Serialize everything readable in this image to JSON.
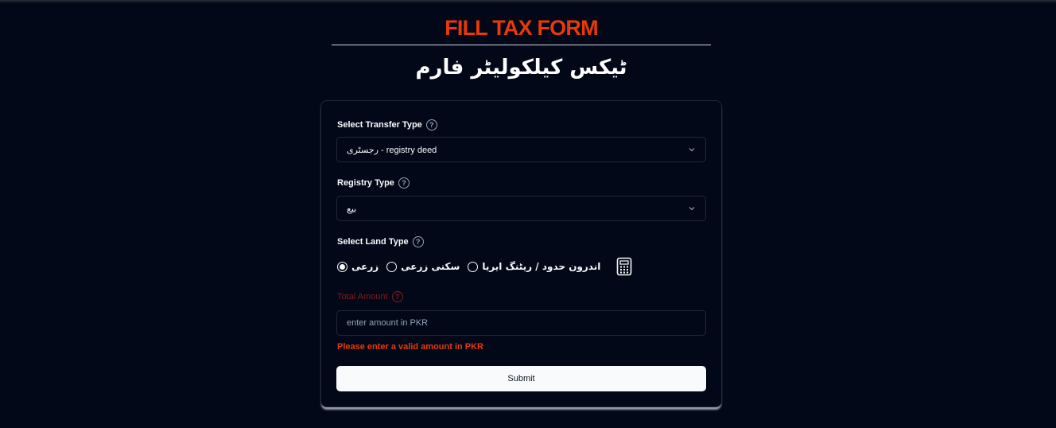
{
  "header": {
    "title": "FILL TAX FORM",
    "subtitle": "ٹیکس کیلکولیٹر فارم"
  },
  "form": {
    "transfer_type": {
      "label": "Select Transfer Type",
      "value": "رجسٹری - registry deed"
    },
    "registry_type": {
      "label": "Registry Type",
      "value": "بیع"
    },
    "land_type": {
      "label": "Select Land Type",
      "options": [
        {
          "label": "زرعی",
          "checked": true
        },
        {
          "label": "سکنی زرعی",
          "checked": false
        },
        {
          "label": "اندرون حدود / ریٹنگ ایریا",
          "checked": false
        }
      ],
      "calculator_icon": "calculator-icon"
    },
    "total_amount": {
      "label": "Total Amount",
      "placeholder": "enter amount in PKR",
      "value": "",
      "error": "Please enter a valid amount in PKR"
    },
    "submit_label": "Submit"
  },
  "colors": {
    "background": "#020817",
    "accent": "#e8380c",
    "error_label": "#7f1d1d",
    "button_bg": "#f8fafc"
  }
}
